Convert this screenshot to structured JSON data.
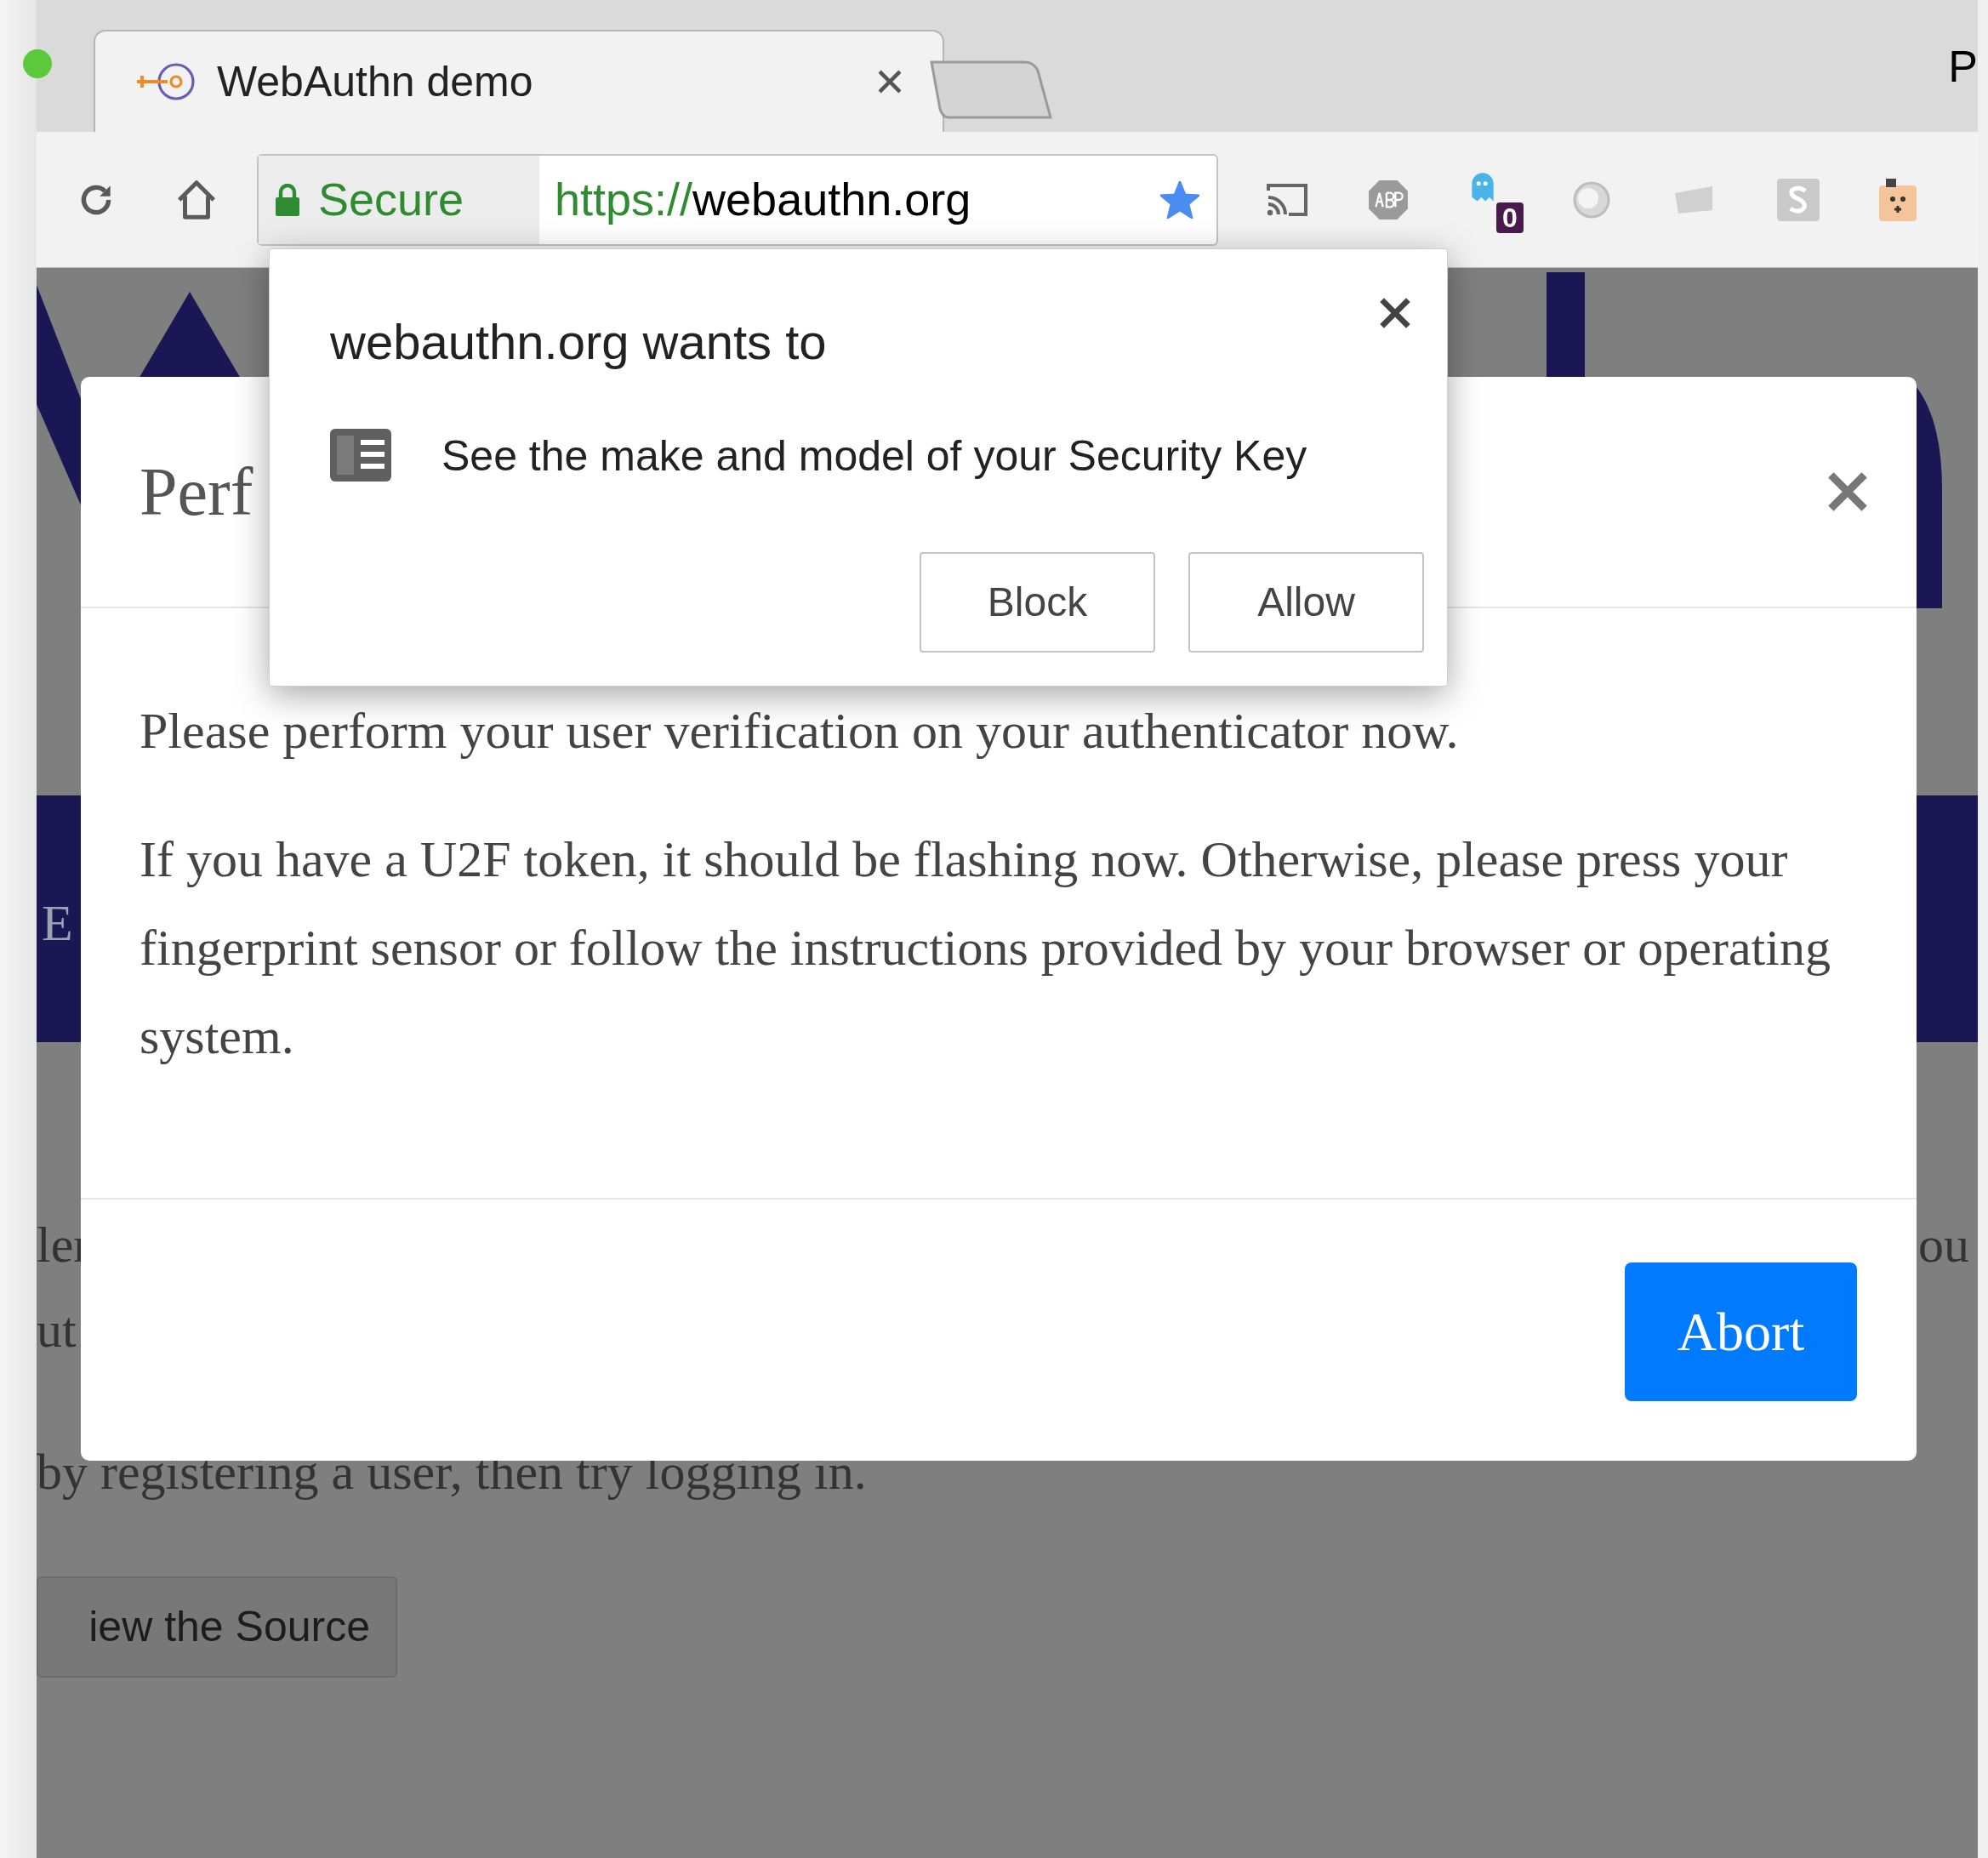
{
  "browser": {
    "tabs": [
      {
        "title": "WebAuthn demo",
        "selected": true
      }
    ],
    "edge_text": "P",
    "security_label": "Secure",
    "url_scheme": "https://",
    "url_host": "webauthn.org",
    "bookmarked": true,
    "extension_badge": "0"
  },
  "page_background": {
    "fragments": [
      "E",
      "ler",
      "ou",
      "ut",
      "by registering a user, then try logging in."
    ],
    "button": "iew the Source"
  },
  "modal": {
    "title": "Perf",
    "paragraphs": [
      "Please perform your user verification on your authenticator now.",
      "If you have a U2F token, it should be flashing now. Otherwise, please press your fingerprint sensor or follow the instructions provided by your browser or operating system."
    ],
    "abort_button": "Abort"
  },
  "permission_popup": {
    "title": "webauthn.org wants to",
    "request": "See the make and model of your Security Key",
    "buttons": [
      "Block",
      "Allow"
    ]
  }
}
